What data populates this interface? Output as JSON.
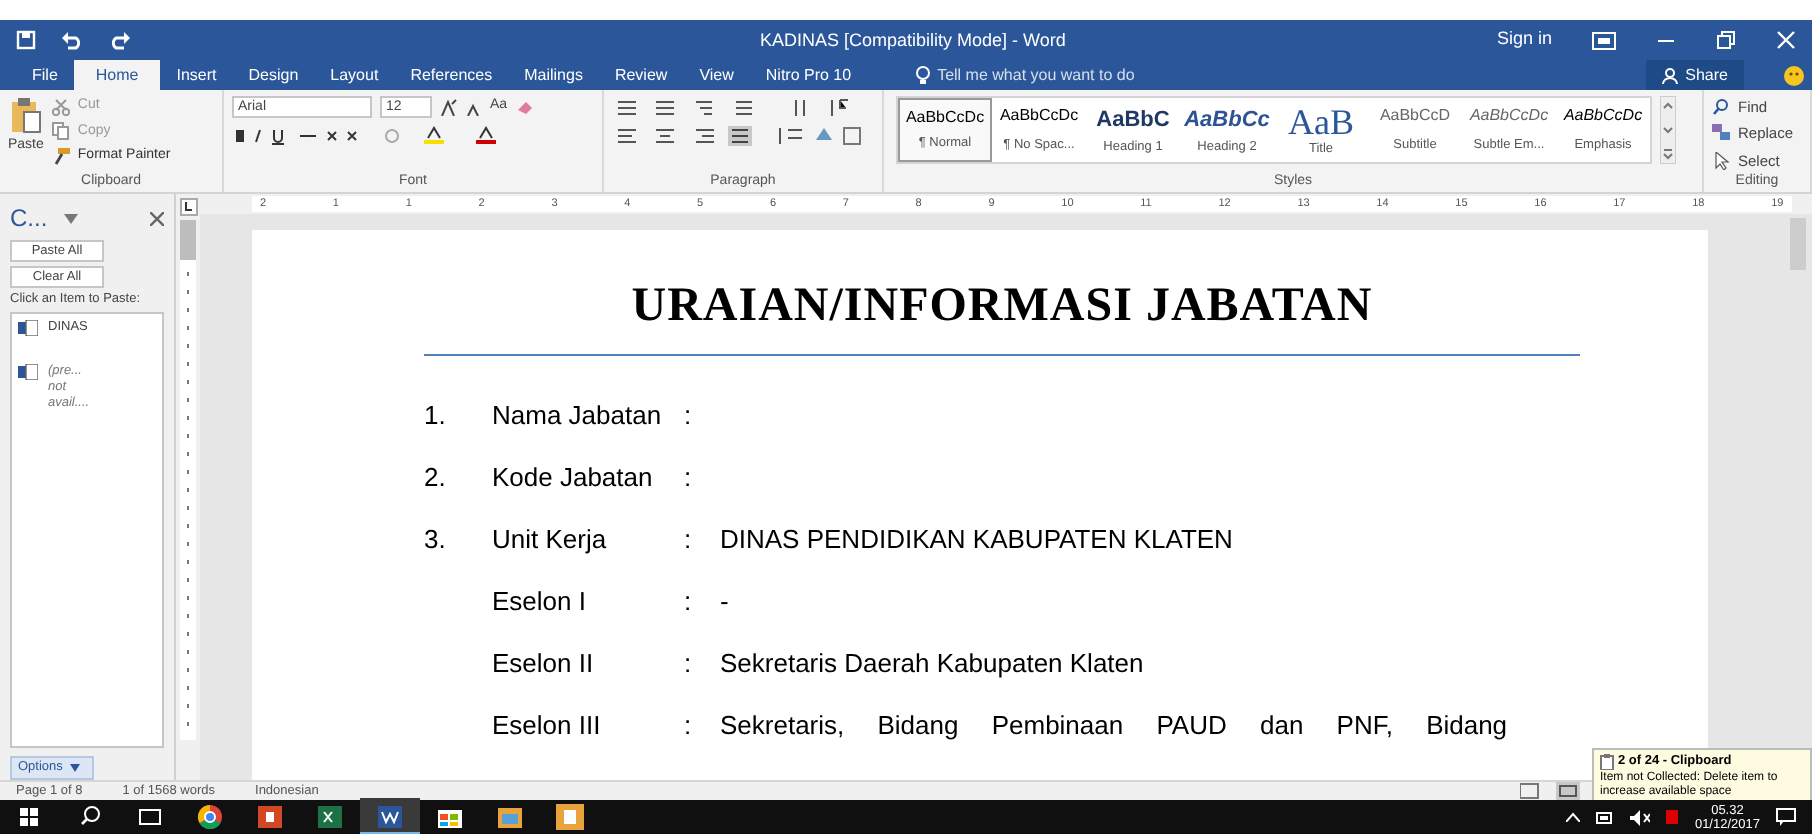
{
  "title_bar": {
    "title": "KADINAS [Compatibility Mode] - Word",
    "sign_in": "Sign in"
  },
  "tabs": [
    {
      "label": "File",
      "selected": false
    },
    {
      "label": "Home",
      "selected": true
    },
    {
      "label": "Insert",
      "selected": false
    },
    {
      "label": "Design",
      "selected": false
    },
    {
      "label": "Layout",
      "selected": false
    },
    {
      "label": "References",
      "selected": false
    },
    {
      "label": "Mailings",
      "selected": false
    },
    {
      "label": "Review",
      "selected": false
    },
    {
      "label": "View",
      "selected": false
    },
    {
      "label": "Nitro Pro 10",
      "selected": false
    }
  ],
  "tell_me": {
    "placeholder": "Tell me what you want to do"
  },
  "share": "Share",
  "clipboard_group": {
    "paste": "Paste",
    "cut": "Cut",
    "copy": "Copy",
    "format_painter": "Format Painter",
    "label": "Clipboard"
  },
  "font_group": {
    "font_name": "Arial",
    "font_size": "12",
    "case": "Aa",
    "label": "Font"
  },
  "paragraph_group": {
    "label": "Paragraph"
  },
  "styles_group": {
    "label": "Styles",
    "styles": [
      {
        "preview": "AaBbCcDc",
        "name": "¶ Normal",
        "selected": true
      },
      {
        "preview": "AaBbCcDc",
        "name": "¶ No Spac...",
        "selected": false
      },
      {
        "preview": "AaBbC",
        "name": "Heading 1",
        "selected": false
      },
      {
        "preview": "AaBbCc",
        "name": "Heading 2",
        "selected": false
      },
      {
        "preview": "AaB",
        "name": "Title",
        "selected": false
      },
      {
        "preview": "AaBbCcD",
        "name": "Subtitle",
        "selected": false
      },
      {
        "preview": "AaBbCcDc",
        "name": "Subtle Em...",
        "selected": false
      },
      {
        "preview": "AaBbCcDc",
        "name": "Emphasis",
        "selected": false
      }
    ]
  },
  "editing_group": {
    "find": "Find",
    "replace": "Replace",
    "select": "Select",
    "label": "Editing"
  },
  "ruler": {
    "labels": [
      "2",
      "1",
      "1",
      "2",
      "3",
      "4",
      "5",
      "6",
      "7",
      "8",
      "9",
      "10",
      "11",
      "12",
      "13",
      "14",
      "15",
      "16",
      "17",
      "18",
      "19"
    ]
  },
  "clipboard_pane": {
    "title": "C...",
    "buttons": [
      "Paste All",
      "Clear All"
    ],
    "hint": "Click an Item to Paste:",
    "items": [
      {
        "lines": [
          "DINAS"
        ],
        "available": true
      },
      {
        "lines": [
          "(pre...",
          "not",
          "avail...."
        ],
        "available": false
      }
    ],
    "options": "Options"
  },
  "document": {
    "heading": "URAIAN/INFORMASI JABATAN",
    "rows": [
      {
        "number": "1.",
        "label": "Nama Jabatan",
        "separator": ":",
        "value": ""
      },
      {
        "number": "2.",
        "label": "Kode Jabatan",
        "separator": ":",
        "value": ""
      },
      {
        "number": "3.",
        "label": "Unit Kerja",
        "separator": ":",
        "value": "DINAS PENDIDIKAN KABUPATEN KLATEN"
      },
      {
        "number": "",
        "label": "Eselon I",
        "separator": ":",
        "value": "-"
      },
      {
        "number": "",
        "label": "Eselon II",
        "separator": ":",
        "value": "Sekretaris Daerah Kabupaten Klaten"
      },
      {
        "number": "",
        "label": "Eselon III",
        "separator": ":",
        "value": "Sekretaris, Bidang Pembinaan PAUD dan PNF, Bidang"
      }
    ]
  },
  "status_bar": {
    "page": "Page 1 of 8",
    "words": "1 of 1568 words",
    "language": "Indonesian"
  },
  "notification": {
    "title": "2 of 24 - Clipboard",
    "message": "Item not Collected: Delete item to increase available space"
  },
  "taskbar": {
    "time": "05.32",
    "date": "01/12/2017"
  }
}
